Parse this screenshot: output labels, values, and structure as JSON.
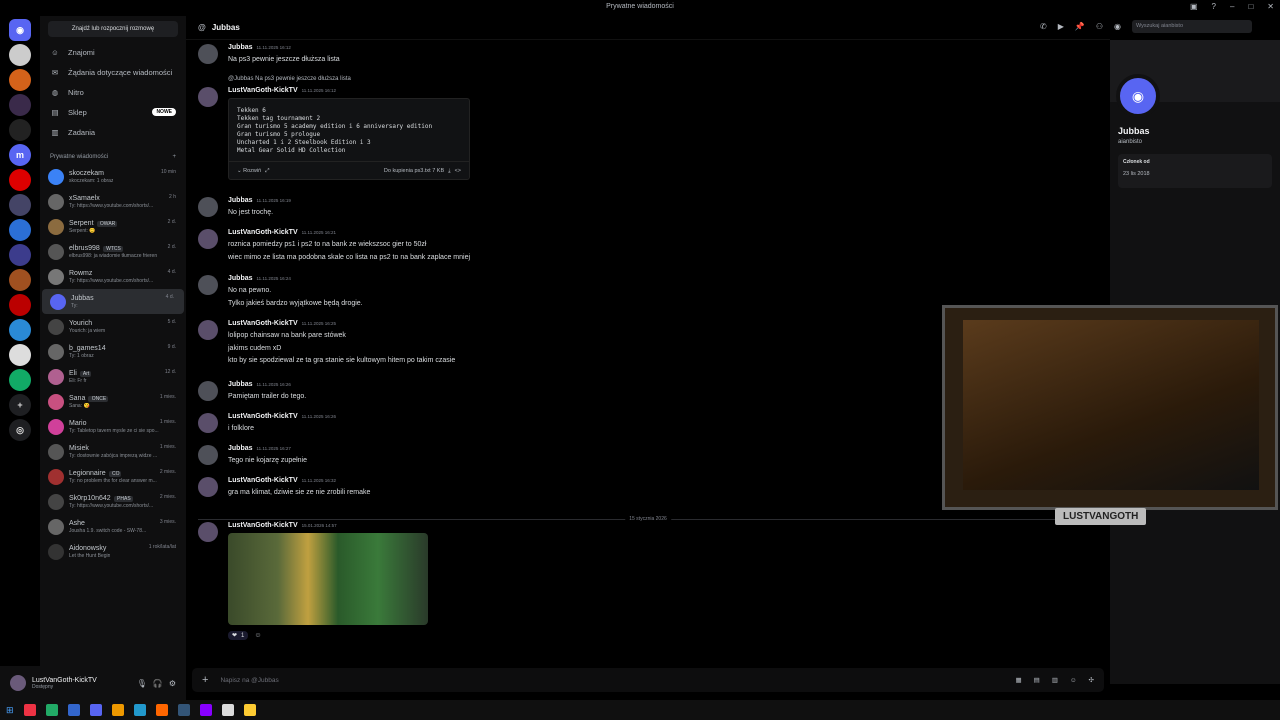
{
  "window": {
    "title": "Prywatne wiadomości"
  },
  "sidebar": {
    "find_label": "Znajdź lub rozpocznij rozmowę",
    "nav": [
      {
        "icon": "friends-icon",
        "label": "Znajomi"
      },
      {
        "icon": "mail-icon",
        "label": "Żądania dotyczące wiadomości"
      },
      {
        "icon": "nitro-icon",
        "label": "Nitro"
      },
      {
        "icon": "shop-icon",
        "label": "Sklep",
        "badge": "NOWE"
      },
      {
        "icon": "quests-icon",
        "label": "Zadania"
      }
    ],
    "dm_header": "Prywatne wiadomości",
    "dm_add": "+",
    "dms": [
      {
        "name": "skoczekam",
        "sub": "skoczekam: 1 obraz",
        "time": "10 min",
        "color": "#3b82f6"
      },
      {
        "name": "xSamaelx",
        "sub": "Ty: https://www.youtube.com/shorts/...",
        "time": "2 h",
        "color": "#666"
      },
      {
        "name": "Serpent",
        "tag": "OWAR",
        "sub": "Serpent: 😊",
        "time": "2 d.",
        "color": "#8b6b3f"
      },
      {
        "name": "elbrus998",
        "tag": "WTCS",
        "sub": "elbrus998: ja wiadomie tłumacze frieren",
        "time": "2 d.",
        "color": "#555"
      },
      {
        "name": "Rowmz",
        "sub": "Ty: https://www.youtube.com/shorts/...",
        "time": "4 d.",
        "color": "#777"
      },
      {
        "name": "Jubbas",
        "sub": "Ty:",
        "time": "4 d.",
        "color": "#5865f2",
        "active": true
      },
      {
        "name": "Yourich",
        "sub": "Yourich: ja wiem",
        "time": "5 d.",
        "color": "#444"
      },
      {
        "name": "b_games14",
        "sub": "Ty: 1 obraz",
        "time": "9 d.",
        "color": "#666"
      },
      {
        "name": "Eli",
        "tag": "Art",
        "sub": "Eli: Fr fr",
        "time": "12 d.",
        "color": "#b06090"
      },
      {
        "name": "Sana",
        "tag": "ONCE",
        "sub": "Sana: 😘",
        "time": "1 mies.",
        "color": "#c85080"
      },
      {
        "name": "Mario",
        "sub": "Ty: Tabletop tavern mysle ze ci sie spo...",
        "time": "1 mies.",
        "color": "#d0409a"
      },
      {
        "name": "Misiek",
        "sub": "Ty: dostownie zabójca imprezą widze ...",
        "time": "1 mies.",
        "color": "#555"
      },
      {
        "name": "Legionnaire",
        "tag": "CO",
        "sub": "Ty: no problem thx for clear answer m...",
        "time": "2 mies.",
        "color": "#a03030"
      },
      {
        "name": "Sk0rp10n642",
        "tag": "PHAS",
        "sub": "Ty: https://www.youtube.com/shorts/...",
        "time": "2 mies.",
        "color": "#444"
      },
      {
        "name": "Ashe",
        "sub": "Jousha 1.9. switch code - SW-78...",
        "time": "3 mies.",
        "color": "#666"
      },
      {
        "name": "Aidonowsky",
        "sub": "Let the Hunt Begin",
        "time": "1 rok/lata/lat",
        "color": "#333"
      }
    ]
  },
  "user": {
    "name": "LustVanGoth-KickTV",
    "status": "Dostępny"
  },
  "chat": {
    "header": "Jubbas",
    "search_placeholder": "Wyszukaj aianbisto",
    "divider": "15 stycznia 2026",
    "composer_placeholder": "Napisz na @Jubbas",
    "messages": [
      {
        "author": "Jubbas",
        "time": "11.11.2025 16:12",
        "lines": [
          "Na ps3 pewnie jeszcze dłuższa lista"
        ]
      },
      {
        "reply": "@Jubbas Na ps3 pewnie jeszcze dłuższa lista",
        "author": "LustVanGoth-KickTV",
        "time": "11.11.2025 16:12",
        "code": [
          "Tekken 6",
          "Tekken tag tournament 2",
          "Gran turismo 5 academy edition i 6 anniversary edition",
          "Gran turismo 5 prologue",
          "Uncharted 1 i 2 Steelbook Edition i 3",
          "Metal Gear Solid HD Collection"
        ],
        "expand": "Rozwiń",
        "file": "Do kupienia ps3.txt 7 KB"
      },
      {
        "author": "Jubbas",
        "time": "11.11.2025 16:19",
        "lines": [
          "No jest trochę."
        ]
      },
      {
        "author": "LustVanGoth-KickTV",
        "time": "11.11.2025 16:21",
        "lines": [
          "roznica pomiedzy ps1 i ps2 to na bank ze wiekszsoc gier to 50zł",
          "wiec mimo ze lista ma podobna skale co lista na ps2 to na bank zaplace mniej"
        ]
      },
      {
        "author": "Jubbas",
        "time": "11.11.2025 16:24",
        "lines": [
          "No na pewno.",
          "Tylko jakieś bardzo wyjątkowe będą drogie."
        ]
      },
      {
        "author": "LustVanGoth-KickTV",
        "time": "11.11.2025 16:25",
        "lines": [
          "lolipop chainsaw na bank pare stówek",
          "jakims cudem xD",
          "kto by sie spodziewal ze ta gra stanie sie kultowym hitem po takim czasie"
        ]
      },
      {
        "author": "Jubbas",
        "time": "11.11.2025 16:26",
        "lines": [
          "Pamiętam trailer do tego."
        ]
      },
      {
        "author": "LustVanGoth-KickTV",
        "time": "11.11.2025 16:26",
        "lines": [
          "i folklore"
        ]
      },
      {
        "author": "Jubbas",
        "time": "11.11.2025 16:27",
        "lines": [
          "Tego nie kojarzę zupełnie"
        ]
      },
      {
        "author": "LustVanGoth-KickTV",
        "time": "11.11.2025 16:32",
        "lines": [
          "gra ma klimat, dziwie sie ze nie zrobili remake"
        ]
      },
      {
        "author": "LustVanGoth-KickTV",
        "time": "15.01.2026 14:57",
        "image": true,
        "reaction": "1"
      }
    ]
  },
  "profile": {
    "name": "Jubbas",
    "handle": "aianbisto",
    "member_label": "Członek od",
    "member_since": "23 lis 2018"
  },
  "webcam": {
    "overlay_name": "LUSTVANGOTH"
  },
  "colors": {
    "blurple": "#5865f2",
    "bg": "#000000",
    "sidebar": "#0f0f10"
  }
}
